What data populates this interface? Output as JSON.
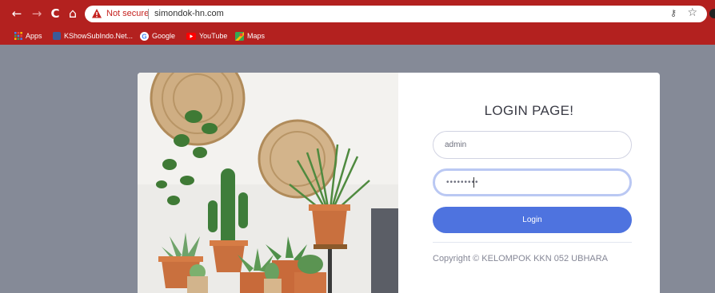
{
  "browser": {
    "nav": {
      "back": "←",
      "forward": "→",
      "reload": "C",
      "home": "⌂"
    },
    "security_label": "Not secure",
    "url": "simondok-hn.com",
    "icons": {
      "warning": "warning-triangle-icon",
      "key": "key-icon",
      "star": "star-icon"
    },
    "bookmarks": [
      {
        "label": "Apps",
        "icon": "apps-grid-icon",
        "color": "#f4b400"
      },
      {
        "label": "KShowSubIndo.Net...",
        "icon": "site-favicon-icon",
        "color": "#3c5a99"
      },
      {
        "label": "Google",
        "icon": "google-icon",
        "color": "#ffffff"
      },
      {
        "label": "YouTube",
        "icon": "youtube-icon",
        "color": "#ff0000"
      },
      {
        "label": "Maps",
        "icon": "maps-icon",
        "color": "#34a853"
      }
    ],
    "theme_color": "#b3211f"
  },
  "login": {
    "title": "LOGIN PAGE!",
    "username_value": "admin",
    "password_value": "•••••••••",
    "button_label": "Login",
    "copyright": "Copyright © KELOMPOK KKN 052 UBHARA",
    "accent_color": "#4e73df"
  },
  "page": {
    "background_color": "#858a97"
  }
}
